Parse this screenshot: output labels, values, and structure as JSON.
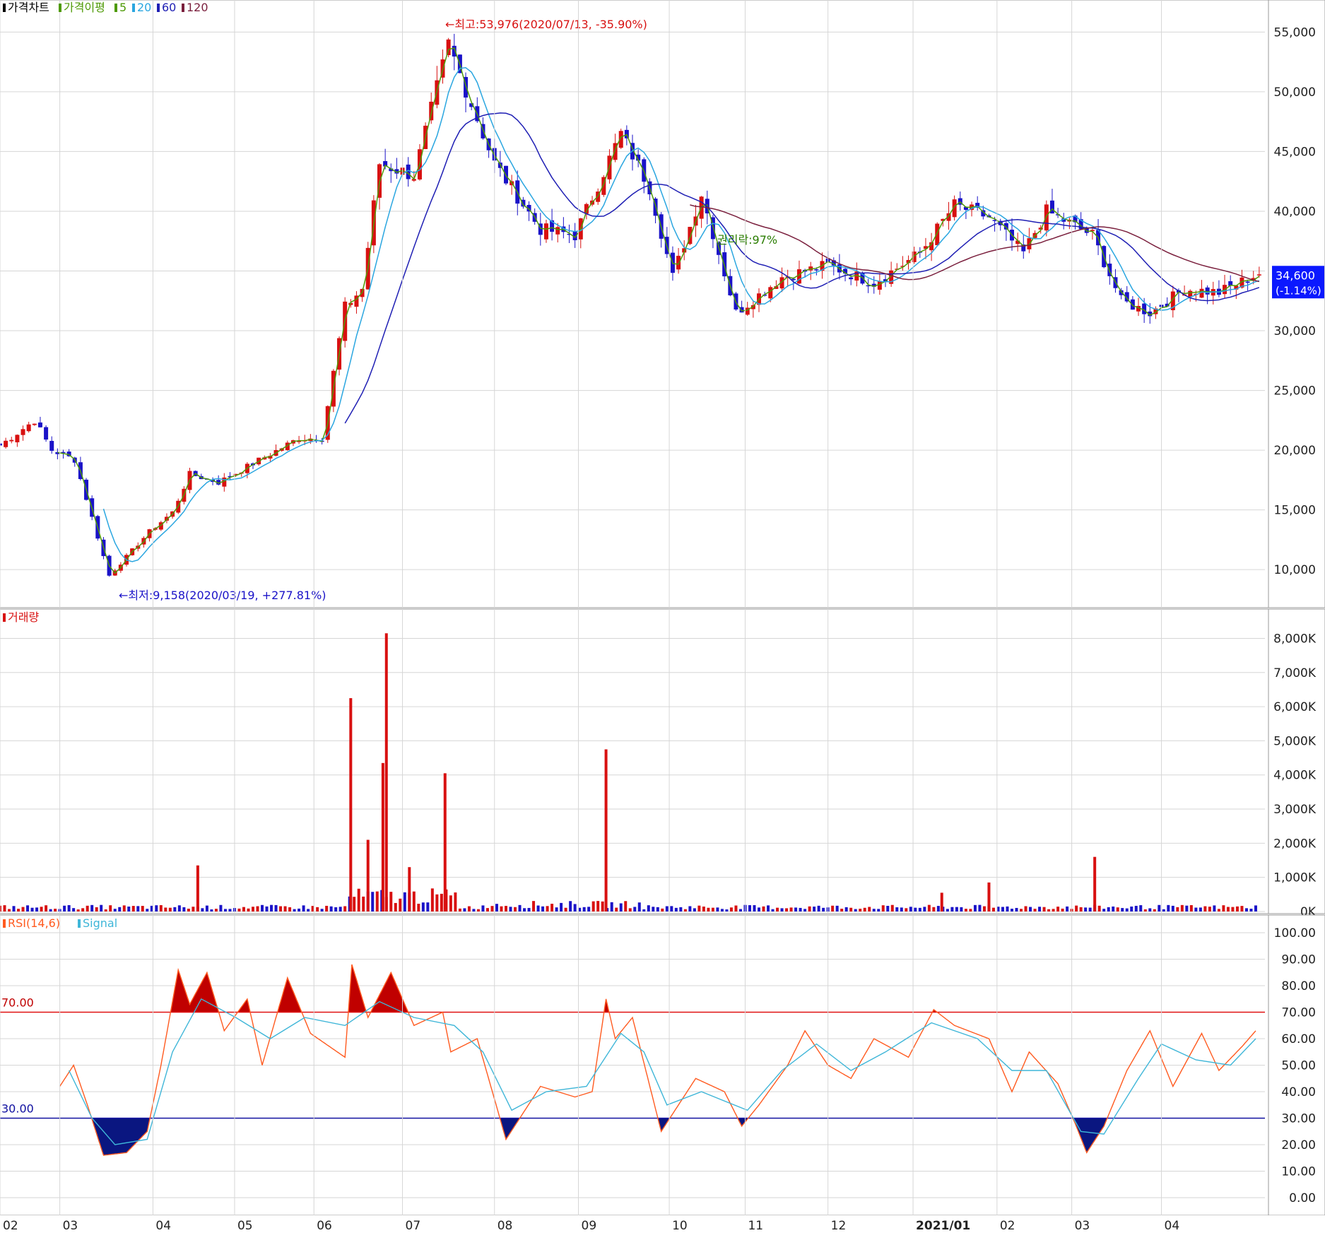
{
  "colors": {
    "up": "#d81010",
    "down": "#1a12c8",
    "ma5": "#4e9a06",
    "ma20": "#2aa6e0",
    "ma60": "#1f1fb4",
    "ma120": "#7a1f3d",
    "rsi": "#ff5a1f",
    "signal": "#3fb6d8",
    "grid": "#d6d6d6",
    "last_price_bg": "#0b18ff"
  },
  "panels": {
    "price": {
      "legend": [
        {
          "marker_color": "#000000",
          "label": "가격차트"
        },
        {
          "marker_color": "#4e9a06",
          "label": "가격이평"
        },
        {
          "marker_color": "#4e9a06",
          "label": "5"
        },
        {
          "marker_color": "#2aa6e0",
          "label": "20"
        },
        {
          "marker_color": "#1f1fb4",
          "label": "60"
        },
        {
          "marker_color": "#7a1f3d",
          "label": "120"
        }
      ],
      "high_annotation": "←최고:53,976(2020/07/13, -35.90%)",
      "low_annotation": "←최저:9,158(2020/03/19, +277.81%)",
      "rights_annotation": "권리락:97%",
      "last_price": "34,600",
      "last_change": "(-1.14%)"
    },
    "volume": {
      "legend": "거래량"
    },
    "rsi": {
      "legend_rsi": "RSI(14,6)",
      "legend_signal": "Signal",
      "level_70_label": "70.00",
      "level_30_label": "30.00"
    }
  },
  "chart_data": [
    {
      "type": "candlestick",
      "title": "가격차트",
      "y_ticks": [
        "55,000",
        "50,000",
        "45,000",
        "40,000",
        "35,000",
        "30,000",
        "25,000",
        "20,000",
        "15,000",
        "10,000"
      ],
      "ylim": [
        8000,
        56500
      ],
      "overlays": [
        "MA5",
        "MA20",
        "MA60",
        "MA120"
      ],
      "approx_close_path": [
        {
          "x": 0,
          "y": 20400
        },
        {
          "x": 30,
          "y": 22500
        },
        {
          "x": 45,
          "y": 20000
        },
        {
          "x": 65,
          "y": 19200
        },
        {
          "x": 95,
          "y": 9500
        },
        {
          "x": 130,
          "y": 13200
        },
        {
          "x": 150,
          "y": 14800
        },
        {
          "x": 165,
          "y": 18000
        },
        {
          "x": 190,
          "y": 17300
        },
        {
          "x": 260,
          "y": 21000
        },
        {
          "x": 280,
          "y": 21000
        },
        {
          "x": 300,
          "y": 32000
        },
        {
          "x": 315,
          "y": 33500
        },
        {
          "x": 330,
          "y": 44000
        },
        {
          "x": 360,
          "y": 43000
        },
        {
          "x": 390,
          "y": 53976
        },
        {
          "x": 430,
          "y": 44000
        },
        {
          "x": 470,
          "y": 38500
        },
        {
          "x": 500,
          "y": 38000
        },
        {
          "x": 540,
          "y": 46500
        },
        {
          "x": 565,
          "y": 42000
        },
        {
          "x": 585,
          "y": 34500
        },
        {
          "x": 610,
          "y": 41500
        },
        {
          "x": 640,
          "y": 31500
        },
        {
          "x": 680,
          "y": 34500
        },
        {
          "x": 720,
          "y": 35500
        },
        {
          "x": 760,
          "y": 34000
        },
        {
          "x": 800,
          "y": 36500
        },
        {
          "x": 830,
          "y": 40500
        },
        {
          "x": 860,
          "y": 39500
        },
        {
          "x": 890,
          "y": 36500
        },
        {
          "x": 910,
          "y": 40000
        },
        {
          "x": 950,
          "y": 38000
        },
        {
          "x": 975,
          "y": 32500
        },
        {
          "x": 1000,
          "y": 31500
        },
        {
          "x": 1030,
          "y": 33500
        },
        {
          "x": 1060,
          "y": 33200
        },
        {
          "x": 1095,
          "y": 34800
        }
      ]
    },
    {
      "type": "bar",
      "title": "거래량",
      "y_ticks": [
        "8,000K",
        "7,000K",
        "6,000K",
        "5,000K",
        "4,000K",
        "3,000K",
        "2,000K",
        "1,000K",
        "0K"
      ],
      "ylim": [
        0,
        8300
      ],
      "spikes_k": [
        {
          "x": 172,
          "value": 1350
        },
        {
          "x": 305,
          "value": 6250
        },
        {
          "x": 320,
          "value": 2100
        },
        {
          "x": 333,
          "value": 4350
        },
        {
          "x": 336,
          "value": 8150
        },
        {
          "x": 356,
          "value": 1300
        },
        {
          "x": 387,
          "value": 4050
        },
        {
          "x": 527,
          "value": 4750
        },
        {
          "x": 819,
          "value": 550
        },
        {
          "x": 860,
          "value": 850
        },
        {
          "x": 952,
          "value": 1600
        }
      ],
      "typical_k": 150
    },
    {
      "type": "line",
      "title": "RSI(14,6)",
      "y_ticks": [
        "100.00",
        "90.00",
        "80.00",
        "70.00",
        "60.00",
        "50.00",
        "40.00",
        "30.00",
        "20.00",
        "10.00",
        "0.00"
      ],
      "ylim": [
        0,
        100
      ],
      "levels": [
        70,
        30
      ],
      "series": [
        {
          "name": "RSI(14,6)",
          "points": [
            {
              "x": 52,
              "y": 42
            },
            {
              "x": 64,
              "y": 50
            },
            {
              "x": 76,
              "y": 35
            },
            {
              "x": 90,
              "y": 16
            },
            {
              "x": 110,
              "y": 17
            },
            {
              "x": 128,
              "y": 25
            },
            {
              "x": 140,
              "y": 50
            },
            {
              "x": 155,
              "y": 86
            },
            {
              "x": 165,
              "y": 73
            },
            {
              "x": 180,
              "y": 85
            },
            {
              "x": 195,
              "y": 63
            },
            {
              "x": 215,
              "y": 75
            },
            {
              "x": 228,
              "y": 50
            },
            {
              "x": 250,
              "y": 83
            },
            {
              "x": 270,
              "y": 62
            },
            {
              "x": 300,
              "y": 53
            },
            {
              "x": 306,
              "y": 88
            },
            {
              "x": 320,
              "y": 68
            },
            {
              "x": 340,
              "y": 85
            },
            {
              "x": 360,
              "y": 65
            },
            {
              "x": 385,
              "y": 70
            },
            {
              "x": 392,
              "y": 55
            },
            {
              "x": 415,
              "y": 60
            },
            {
              "x": 440,
              "y": 22
            },
            {
              "x": 470,
              "y": 42
            },
            {
              "x": 500,
              "y": 38
            },
            {
              "x": 515,
              "y": 40
            },
            {
              "x": 527,
              "y": 75
            },
            {
              "x": 535,
              "y": 60
            },
            {
              "x": 550,
              "y": 68
            },
            {
              "x": 575,
              "y": 25
            },
            {
              "x": 605,
              "y": 45
            },
            {
              "x": 630,
              "y": 40
            },
            {
              "x": 645,
              "y": 27
            },
            {
              "x": 660,
              "y": 35
            },
            {
              "x": 685,
              "y": 50
            },
            {
              "x": 700,
              "y": 63
            },
            {
              "x": 720,
              "y": 50
            },
            {
              "x": 740,
              "y": 45
            },
            {
              "x": 760,
              "y": 60
            },
            {
              "x": 790,
              "y": 53
            },
            {
              "x": 812,
              "y": 71
            },
            {
              "x": 830,
              "y": 65
            },
            {
              "x": 860,
              "y": 60
            },
            {
              "x": 880,
              "y": 40
            },
            {
              "x": 895,
              "y": 55
            },
            {
              "x": 920,
              "y": 43
            },
            {
              "x": 935,
              "y": 28
            },
            {
              "x": 945,
              "y": 17
            },
            {
              "x": 960,
              "y": 27
            },
            {
              "x": 980,
              "y": 48
            },
            {
              "x": 1000,
              "y": 63
            },
            {
              "x": 1020,
              "y": 42
            },
            {
              "x": 1045,
              "y": 62
            },
            {
              "x": 1060,
              "y": 48
            },
            {
              "x": 1080,
              "y": 57
            },
            {
              "x": 1092,
              "y": 63
            }
          ]
        },
        {
          "name": "Signal",
          "points": [
            {
              "x": 60,
              "y": 48
            },
            {
              "x": 80,
              "y": 30
            },
            {
              "x": 100,
              "y": 20
            },
            {
              "x": 128,
              "y": 22
            },
            {
              "x": 150,
              "y": 55
            },
            {
              "x": 175,
              "y": 75
            },
            {
              "x": 205,
              "y": 68
            },
            {
              "x": 235,
              "y": 60
            },
            {
              "x": 265,
              "y": 68
            },
            {
              "x": 300,
              "y": 65
            },
            {
              "x": 330,
              "y": 74
            },
            {
              "x": 360,
              "y": 68
            },
            {
              "x": 395,
              "y": 65
            },
            {
              "x": 420,
              "y": 55
            },
            {
              "x": 445,
              "y": 33
            },
            {
              "x": 475,
              "y": 40
            },
            {
              "x": 510,
              "y": 42
            },
            {
              "x": 540,
              "y": 62
            },
            {
              "x": 560,
              "y": 55
            },
            {
              "x": 580,
              "y": 35
            },
            {
              "x": 610,
              "y": 40
            },
            {
              "x": 650,
              "y": 33
            },
            {
              "x": 680,
              "y": 48
            },
            {
              "x": 710,
              "y": 58
            },
            {
              "x": 740,
              "y": 48
            },
            {
              "x": 770,
              "y": 55
            },
            {
              "x": 810,
              "y": 66
            },
            {
              "x": 850,
              "y": 60
            },
            {
              "x": 880,
              "y": 48
            },
            {
              "x": 910,
              "y": 48
            },
            {
              "x": 940,
              "y": 25
            },
            {
              "x": 960,
              "y": 24
            },
            {
              "x": 990,
              "y": 45
            },
            {
              "x": 1010,
              "y": 58
            },
            {
              "x": 1040,
              "y": 52
            },
            {
              "x": 1070,
              "y": 50
            },
            {
              "x": 1092,
              "y": 60
            }
          ]
        }
      ]
    }
  ],
  "x_axis": {
    "labels": [
      {
        "label": "02",
        "x": 0
      },
      {
        "label": "03",
        "x": 52
      },
      {
        "label": "04",
        "x": 133
      },
      {
        "label": "05",
        "x": 204
      },
      {
        "label": "06",
        "x": 273
      },
      {
        "label": "07",
        "x": 350
      },
      {
        "label": "08",
        "x": 430
      },
      {
        "label": "09",
        "x": 503
      },
      {
        "label": "10",
        "x": 582
      },
      {
        "label": "11",
        "x": 648
      },
      {
        "label": "12",
        "x": 720
      },
      {
        "label": "2021/01",
        "x": 794
      },
      {
        "label": "02",
        "x": 867
      },
      {
        "label": "03",
        "x": 932
      },
      {
        "label": "04",
        "x": 1010
      }
    ]
  }
}
